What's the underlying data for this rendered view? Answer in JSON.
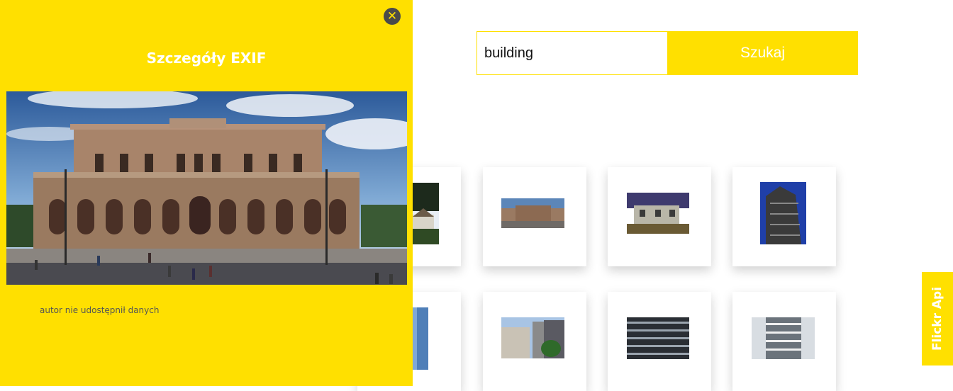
{
  "panel": {
    "title": "Szczegóły EXIF",
    "author_note": "autor nie udostępnił danych",
    "close_icon": "close-icon"
  },
  "search": {
    "value": "building",
    "button_label": "Szukaj"
  },
  "side_tab": {
    "label": "Flickr Api"
  },
  "gallery": {
    "thumbnails": [
      "cottage-photo",
      "town-hall-photo",
      "old-house-photo",
      "skyscraper-photo",
      "glass-tower-photo",
      "street-photo",
      "facade-photo",
      "highrise-photo"
    ]
  },
  "colors": {
    "accent": "#ffe000",
    "close_button": "#4a4a4a",
    "text_light": "#ffffff"
  }
}
